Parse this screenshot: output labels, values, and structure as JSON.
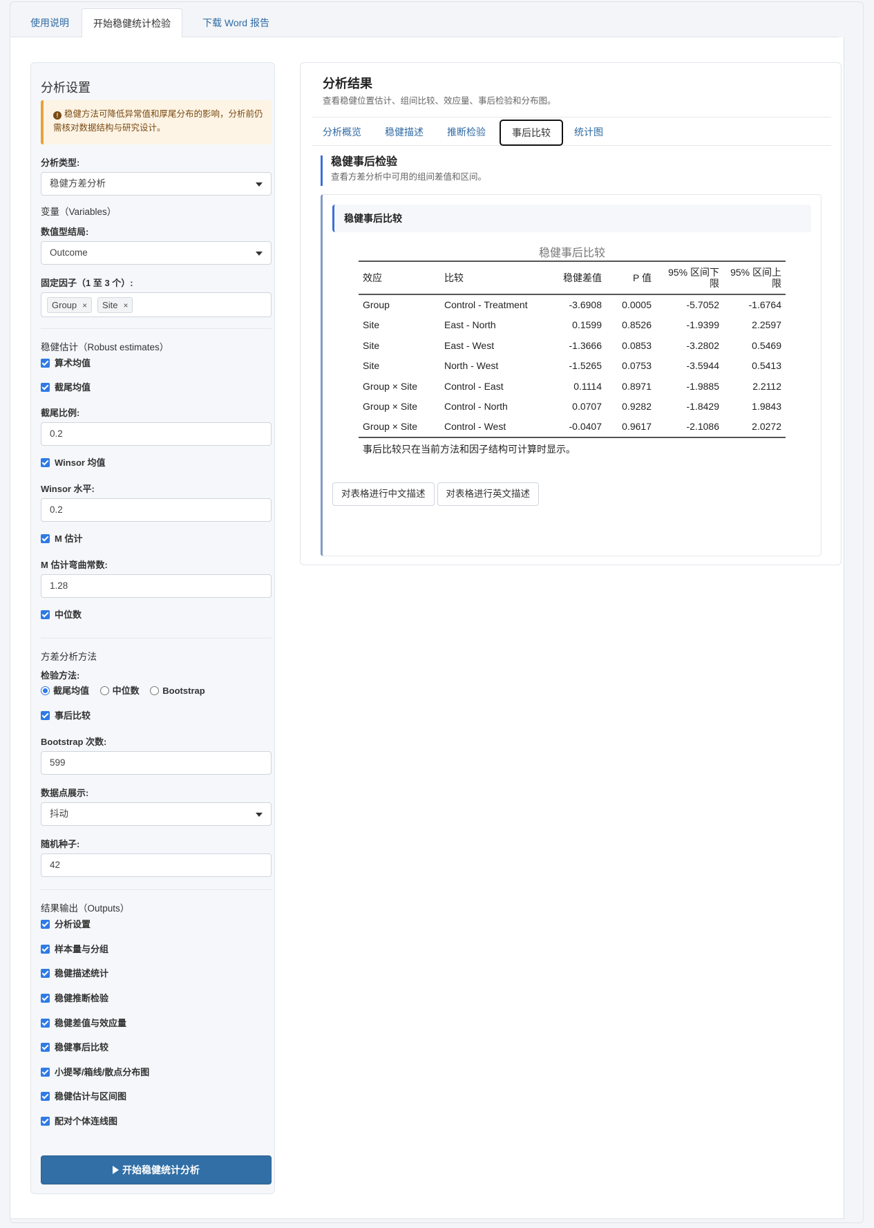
{
  "top_tabs": [
    {
      "label": "使用说明"
    },
    {
      "label": "开始稳健统计检验"
    },
    {
      "label": "下载 Word 报告"
    }
  ],
  "sidebar": {
    "title": "分析设置",
    "notice": "稳健方法可降低异常值和厚尾分布的影响，分析前仍需核对数据结构与研究设计。",
    "analysis_type_label": "分析类型:",
    "analysis_type_value": "稳健方差分析",
    "variables_heading": "变量（Variables）",
    "numeric_label": "数值型结局:",
    "numeric_value": "Outcome",
    "factors_label": "固定因子（1 至 3 个）:",
    "factors": [
      "Group",
      "Site"
    ],
    "estimates_heading": "稳健估计（Robust estimates）",
    "chk_arith_mean": "算术均值",
    "chk_trimmed_mean": "截尾均值",
    "trim_label": "截尾比例:",
    "trim_value": "0.2",
    "chk_winsor": "Winsor 均值",
    "winsor_label": "Winsor 水平:",
    "winsor_value": "0.2",
    "chk_m_est": "M 估计",
    "m_bend_label": "M 估计弯曲常数:",
    "m_bend_value": "1.28",
    "chk_median": "中位数",
    "anova_heading": "方差分析方法",
    "test_method_label": "检验方法:",
    "radio_options": [
      "截尾均值",
      "中位数",
      "Bootstrap"
    ],
    "radio_selected": "截尾均值",
    "chk_posthoc": "事后比较",
    "boot_label": "Bootstrap 次数:",
    "boot_value": "599",
    "points_label": "数据点展示:",
    "points_value": "抖动",
    "seed_label": "随机种子:",
    "seed_value": "42",
    "outputs_heading": "结果输出（Outputs）",
    "outputs": [
      "分析设置",
      "样本量与分组",
      "稳健描述统计",
      "稳健推断检验",
      "稳健差值与效应量",
      "稳健事后比较",
      "小提琴/箱线/散点分布图",
      "稳健估计与区间图",
      "配对个体连线图"
    ],
    "run_button": "开始稳健统计分析"
  },
  "main": {
    "title": "分析结果",
    "subtitle": "查看稳健位置估计、组间比较、效应量、事后检验和分布图。",
    "tabs": [
      {
        "label": "分析概览"
      },
      {
        "label": "稳健描述"
      },
      {
        "label": "推断检验"
      },
      {
        "label": "事后比较"
      },
      {
        "label": "统计图"
      }
    ],
    "section_title": "稳健事后检验",
    "section_sub": "查看方差分析中可用的组间差值和区间。",
    "card_title": "稳健事后比较",
    "table_caption": "稳健事后比较",
    "table_headers": [
      "效应",
      "比较",
      "稳健差值",
      "P 值",
      "95% 区间下限",
      "95% 区间上限"
    ],
    "table_rows": [
      [
        "Group",
        "Control - Treatment",
        "-3.6908",
        "0.0005",
        "-5.7052",
        "-1.6764"
      ],
      [
        "Site",
        "East - North",
        "0.1599",
        "0.8526",
        "-1.9399",
        "2.2597"
      ],
      [
        "Site",
        "East - West",
        "-1.3666",
        "0.0853",
        "-3.2802",
        "0.5469"
      ],
      [
        "Site",
        "North - West",
        "-1.5265",
        "0.0753",
        "-3.5944",
        "0.5413"
      ],
      [
        "Group × Site",
        "Control - East",
        "0.1114",
        "0.8971",
        "-1.9885",
        "2.2112"
      ],
      [
        "Group × Site",
        "Control - North",
        "0.0707",
        "0.9282",
        "-1.8429",
        "1.9843"
      ],
      [
        "Group × Site",
        "Control - West",
        "-0.0407",
        "0.9617",
        "-2.1086",
        "2.0272"
      ]
    ],
    "table_note": "事后比较只在当前方法和因子结构可计算时显示。",
    "btn_cn": "对表格进行中文描述",
    "btn_en": "对表格进行英文描述"
  }
}
